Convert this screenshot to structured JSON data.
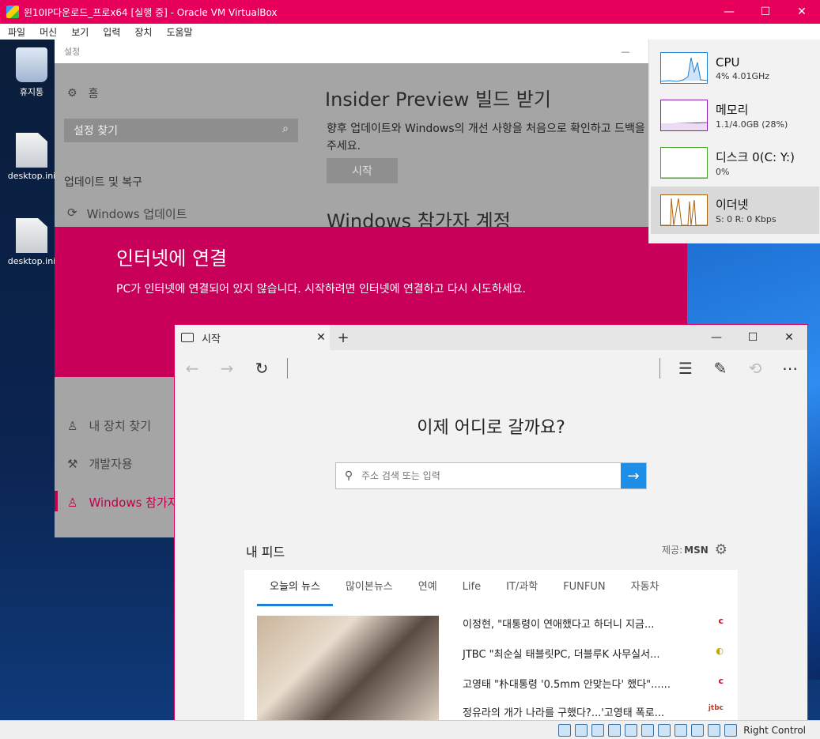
{
  "vbox": {
    "title": "윈10IP다운로드_프로x64 [실행 중] - Oracle VM VirtualBox",
    "menus": [
      "파일",
      "머신",
      "보기",
      "입력",
      "장치",
      "도움말"
    ],
    "status_text": "Right Control"
  },
  "desktop": {
    "icons": [
      {
        "label": "휴지통"
      },
      {
        "label": "desktop.ini"
      },
      {
        "label": "desktop.ini"
      }
    ]
  },
  "settings": {
    "title": "설정",
    "home": "홈",
    "search_placeholder": "설정 찾기",
    "section": "업데이트 및 복구",
    "windows_update": "Windows 업데이트",
    "heading": "Insider Preview 빌드 받기",
    "description": "향후 업데이트와 Windows의 개선 사항을 처음으로 확인하고 드백을 주세요.",
    "start_button": "시작",
    "heading2": "Windows 참가자 계정",
    "nav": [
      {
        "label": "내 장치 찾기"
      },
      {
        "label": "개발자용"
      },
      {
        "label": "Windows 참가자"
      }
    ]
  },
  "connect_error": {
    "title": "인터넷에 연결",
    "message": "PC가 인터넷에 연결되어 있지 않습니다. 시작하려면 인터넷에 연결하고 다시 시도하세요."
  },
  "taskmgr": {
    "items": [
      {
        "name": "CPU",
        "value": "4% 4.01GHz",
        "color": "#1f7fd1"
      },
      {
        "name": "메모리",
        "value": "1.1/4.0GB (28%)",
        "color": "#8b1fb3"
      },
      {
        "name": "디스크 0(C: Y:)",
        "value": "0%",
        "color": "#4aa52e"
      },
      {
        "name": "이더넷",
        "value": "S: 0 R: 0 Kbps",
        "color": "#a86210"
      }
    ]
  },
  "edge": {
    "tab_title": "시작",
    "heading": "이제 어디로 갈까요?",
    "search_placeholder": "주소 검색 또는 입력",
    "my_feed": "내 피드",
    "provider_label": "제공:",
    "provider_name": "MSN",
    "feed_tabs": [
      "오늘의 뉴스",
      "많이본뉴스",
      "연예",
      "Life",
      "IT/과학",
      "FUNFUN",
      "자동차"
    ],
    "news": [
      {
        "title": "이정현, \"대통령이 연애했다고 하더니 지금...",
        "source": "c",
        "color": "#d0102a"
      },
      {
        "title": "JTBC \"최순실 태블릿PC, 더블루K 사무실서...",
        "source": "◐",
        "color": "#c9a300"
      },
      {
        "title": "고영태 \"朴대통령 '0.5mm 안맞는다' 했다\"......",
        "source": "c",
        "color": "#d0102a"
      },
      {
        "title": "정유라의 개가 나라를 구했다?...'고영태 폭로...",
        "source": "jtbc",
        "color": "#c0392b"
      }
    ]
  }
}
